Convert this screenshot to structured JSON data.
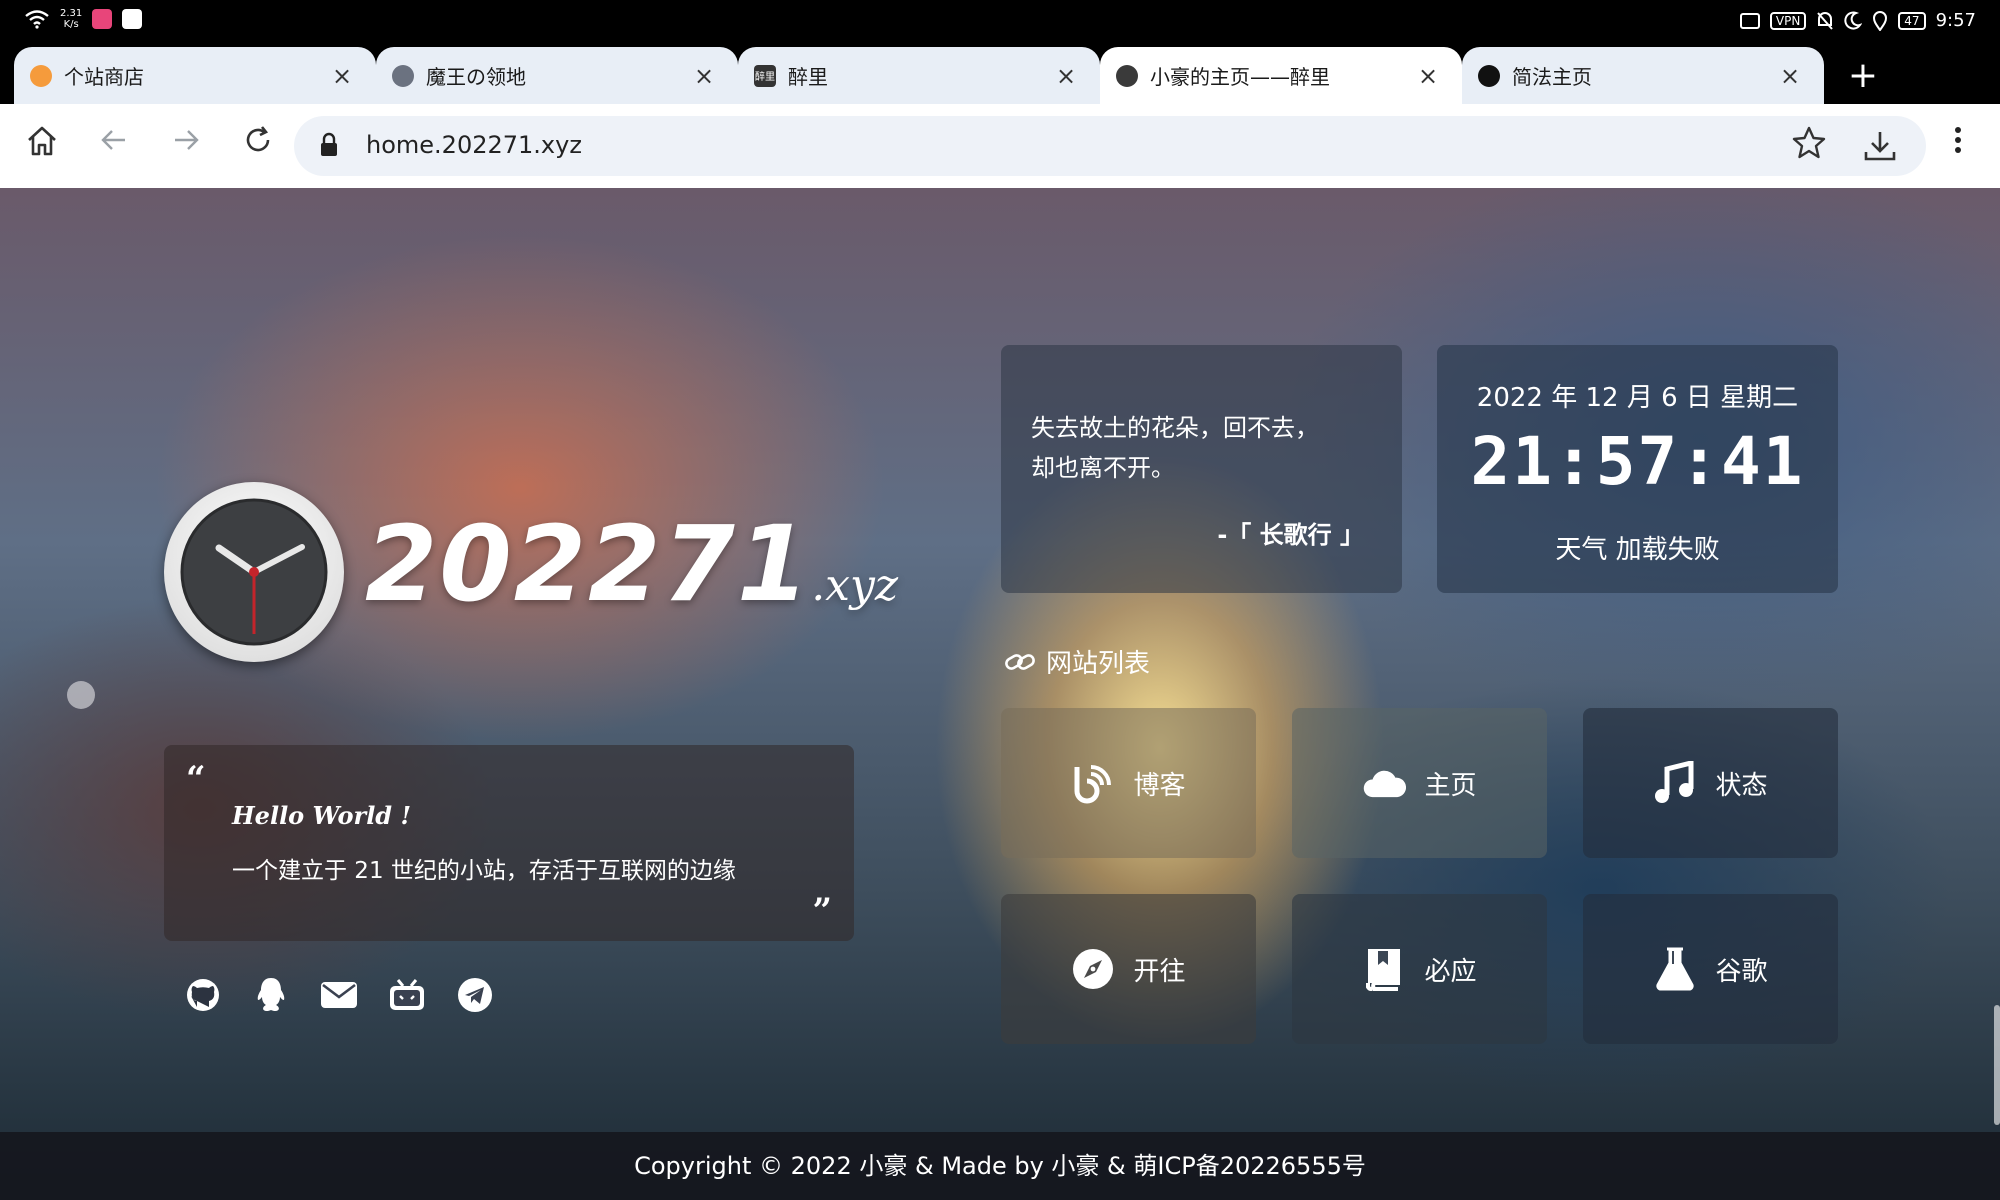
{
  "status_bar": {
    "net_speed_value": "2.31",
    "net_speed_unit": "K/s",
    "vpn_label": "VPN",
    "battery": "47",
    "time": "9:57"
  },
  "tabs": [
    {
      "title": "个站商店",
      "close": "×",
      "fav_color": "#f59b3c",
      "active": false
    },
    {
      "title": "魔王の领地",
      "close": "×",
      "fav_color": "#6b7280",
      "active": false
    },
    {
      "title": "醉里",
      "close": "×",
      "fav_color": "#333333",
      "active": false
    },
    {
      "title": "小豪的主页——醉里",
      "close": "×",
      "fav_color": "#3a3a3a",
      "active": true
    },
    {
      "title": "简法主页",
      "close": "×",
      "fav_color": "#111111",
      "active": false
    }
  ],
  "tab_fav_text": "醉里",
  "new_tab": "+",
  "toolbar": {
    "url": "home.202271.xyz"
  },
  "logo": {
    "main": "202271",
    "tld": ".xyz"
  },
  "hello": {
    "open_quote": "“",
    "title": "Hello World !",
    "desc": "一个建立于 21 世纪的小站，存活于互联网的边缘",
    "close_quote": "”"
  },
  "social_icons": [
    "github-icon",
    "qq-icon",
    "mail-icon",
    "bilibili-icon",
    "telegram-icon"
  ],
  "poem": {
    "line1": "失去故土的花朵，回不去，",
    "line2": "却也离不开。",
    "source": "-「 长歌行 」"
  },
  "datetime": {
    "date": "2022 年 12 月 6 日 星期二",
    "time": "21:57:41",
    "weather": "天气 加载失败"
  },
  "sites_heading": "网站列表",
  "sites": [
    {
      "label": "博客",
      "icon": "blog-icon"
    },
    {
      "label": "主页",
      "icon": "cloud-icon"
    },
    {
      "label": "状态",
      "icon": "music-icon"
    },
    {
      "label": "开往",
      "icon": "compass-icon"
    },
    {
      "label": "必应",
      "icon": "book-icon"
    },
    {
      "label": "谷歌",
      "icon": "flask-icon"
    }
  ],
  "footer": "Copyright © 2022 小豪 & Made by 小豪 & 萌ICP备20226555号",
  "colors": {
    "tab_bg": "#e8eef6",
    "omnibox_bg": "#eef2f8",
    "brand_accent": "#c3242b"
  }
}
